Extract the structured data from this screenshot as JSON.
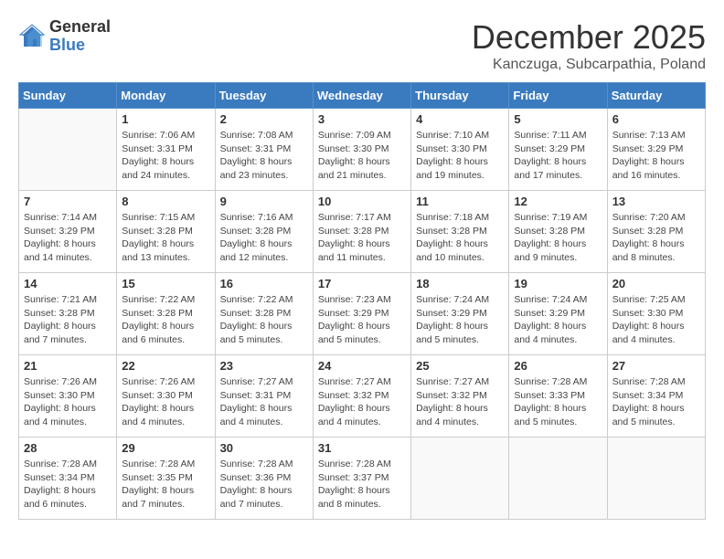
{
  "header": {
    "logo_general": "General",
    "logo_blue": "Blue",
    "month_title": "December 2025",
    "location": "Kanczuga, Subcarpathia, Poland"
  },
  "days_of_week": [
    "Sunday",
    "Monday",
    "Tuesday",
    "Wednesday",
    "Thursday",
    "Friday",
    "Saturday"
  ],
  "weeks": [
    [
      {
        "day": "",
        "content": ""
      },
      {
        "day": "1",
        "content": "Sunrise: 7:06 AM\nSunset: 3:31 PM\nDaylight: 8 hours\nand 24 minutes."
      },
      {
        "day": "2",
        "content": "Sunrise: 7:08 AM\nSunset: 3:31 PM\nDaylight: 8 hours\nand 23 minutes."
      },
      {
        "day": "3",
        "content": "Sunrise: 7:09 AM\nSunset: 3:30 PM\nDaylight: 8 hours\nand 21 minutes."
      },
      {
        "day": "4",
        "content": "Sunrise: 7:10 AM\nSunset: 3:30 PM\nDaylight: 8 hours\nand 19 minutes."
      },
      {
        "day": "5",
        "content": "Sunrise: 7:11 AM\nSunset: 3:29 PM\nDaylight: 8 hours\nand 17 minutes."
      },
      {
        "day": "6",
        "content": "Sunrise: 7:13 AM\nSunset: 3:29 PM\nDaylight: 8 hours\nand 16 minutes."
      }
    ],
    [
      {
        "day": "7",
        "content": "Sunrise: 7:14 AM\nSunset: 3:29 PM\nDaylight: 8 hours\nand 14 minutes."
      },
      {
        "day": "8",
        "content": "Sunrise: 7:15 AM\nSunset: 3:28 PM\nDaylight: 8 hours\nand 13 minutes."
      },
      {
        "day": "9",
        "content": "Sunrise: 7:16 AM\nSunset: 3:28 PM\nDaylight: 8 hours\nand 12 minutes."
      },
      {
        "day": "10",
        "content": "Sunrise: 7:17 AM\nSunset: 3:28 PM\nDaylight: 8 hours\nand 11 minutes."
      },
      {
        "day": "11",
        "content": "Sunrise: 7:18 AM\nSunset: 3:28 PM\nDaylight: 8 hours\nand 10 minutes."
      },
      {
        "day": "12",
        "content": "Sunrise: 7:19 AM\nSunset: 3:28 PM\nDaylight: 8 hours\nand 9 minutes."
      },
      {
        "day": "13",
        "content": "Sunrise: 7:20 AM\nSunset: 3:28 PM\nDaylight: 8 hours\nand 8 minutes."
      }
    ],
    [
      {
        "day": "14",
        "content": "Sunrise: 7:21 AM\nSunset: 3:28 PM\nDaylight: 8 hours\nand 7 minutes."
      },
      {
        "day": "15",
        "content": "Sunrise: 7:22 AM\nSunset: 3:28 PM\nDaylight: 8 hours\nand 6 minutes."
      },
      {
        "day": "16",
        "content": "Sunrise: 7:22 AM\nSunset: 3:28 PM\nDaylight: 8 hours\nand 5 minutes."
      },
      {
        "day": "17",
        "content": "Sunrise: 7:23 AM\nSunset: 3:29 PM\nDaylight: 8 hours\nand 5 minutes."
      },
      {
        "day": "18",
        "content": "Sunrise: 7:24 AM\nSunset: 3:29 PM\nDaylight: 8 hours\nand 5 minutes."
      },
      {
        "day": "19",
        "content": "Sunrise: 7:24 AM\nSunset: 3:29 PM\nDaylight: 8 hours\nand 4 minutes."
      },
      {
        "day": "20",
        "content": "Sunrise: 7:25 AM\nSunset: 3:30 PM\nDaylight: 8 hours\nand 4 minutes."
      }
    ],
    [
      {
        "day": "21",
        "content": "Sunrise: 7:26 AM\nSunset: 3:30 PM\nDaylight: 8 hours\nand 4 minutes."
      },
      {
        "day": "22",
        "content": "Sunrise: 7:26 AM\nSunset: 3:30 PM\nDaylight: 8 hours\nand 4 minutes."
      },
      {
        "day": "23",
        "content": "Sunrise: 7:27 AM\nSunset: 3:31 PM\nDaylight: 8 hours\nand 4 minutes."
      },
      {
        "day": "24",
        "content": "Sunrise: 7:27 AM\nSunset: 3:32 PM\nDaylight: 8 hours\nand 4 minutes."
      },
      {
        "day": "25",
        "content": "Sunrise: 7:27 AM\nSunset: 3:32 PM\nDaylight: 8 hours\nand 4 minutes."
      },
      {
        "day": "26",
        "content": "Sunrise: 7:28 AM\nSunset: 3:33 PM\nDaylight: 8 hours\nand 5 minutes."
      },
      {
        "day": "27",
        "content": "Sunrise: 7:28 AM\nSunset: 3:34 PM\nDaylight: 8 hours\nand 5 minutes."
      }
    ],
    [
      {
        "day": "28",
        "content": "Sunrise: 7:28 AM\nSunset: 3:34 PM\nDaylight: 8 hours\nand 6 minutes."
      },
      {
        "day": "29",
        "content": "Sunrise: 7:28 AM\nSunset: 3:35 PM\nDaylight: 8 hours\nand 7 minutes."
      },
      {
        "day": "30",
        "content": "Sunrise: 7:28 AM\nSunset: 3:36 PM\nDaylight: 8 hours\nand 7 minutes."
      },
      {
        "day": "31",
        "content": "Sunrise: 7:28 AM\nSunset: 3:37 PM\nDaylight: 8 hours\nand 8 minutes."
      },
      {
        "day": "",
        "content": ""
      },
      {
        "day": "",
        "content": ""
      },
      {
        "day": "",
        "content": ""
      }
    ]
  ]
}
